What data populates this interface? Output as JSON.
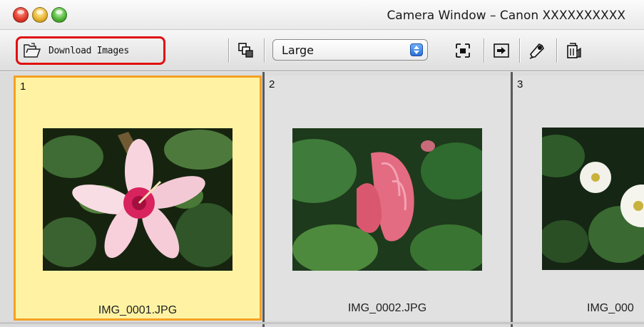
{
  "window": {
    "title": "Camera Window – Canon XXXXXXXXXX",
    "traffic_lights": [
      "close",
      "minimize",
      "zoom"
    ]
  },
  "toolbar": {
    "download_label": "Download Images",
    "download_icon": "folder-open-icon",
    "view_size": "Large",
    "highlight_color": "#e01010",
    "icons": [
      "copy-stack-icon",
      "fit-screen-icon",
      "slideshow-icon",
      "settings-edit-icon",
      "trash-icon"
    ]
  },
  "thumbnails": [
    {
      "number": "1",
      "filename": "IMG_0001.JPG",
      "selected": true
    },
    {
      "number": "2",
      "filename": "IMG_0002.JPG",
      "selected": false
    },
    {
      "number": "3",
      "filename": "IMG_000",
      "selected": false
    }
  ],
  "colors": {
    "selection_fill": "#fff3a3",
    "selection_border": "#f5a023"
  }
}
